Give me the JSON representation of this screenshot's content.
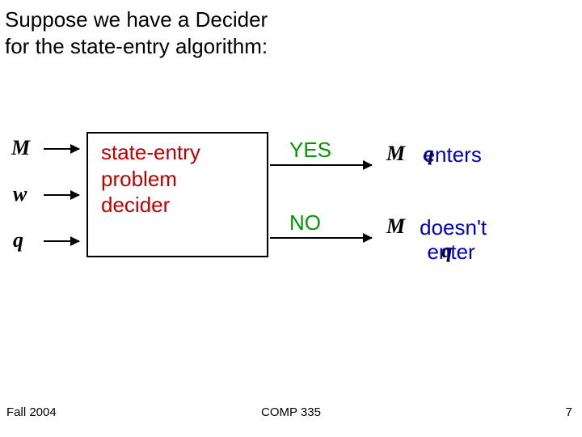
{
  "title_line1": "Suppose we have a Decider",
  "title_line2": "for the state-entry algorithm:",
  "inputs": {
    "M": "M",
    "w": "w",
    "q": "q"
  },
  "decider_line1": "state-entry",
  "decider_line2": "problem",
  "decider_line3": "decider",
  "outputs": {
    "yes": "YES",
    "no": "NO"
  },
  "yes_result": {
    "M": "M",
    "text": "enters",
    "q": "q"
  },
  "no_result": {
    "M": "M",
    "text1": "doesn't",
    "text2": "enter",
    "q": "q"
  },
  "footer": {
    "left": "Fall 2004",
    "center": "COMP 335",
    "right": "7"
  }
}
